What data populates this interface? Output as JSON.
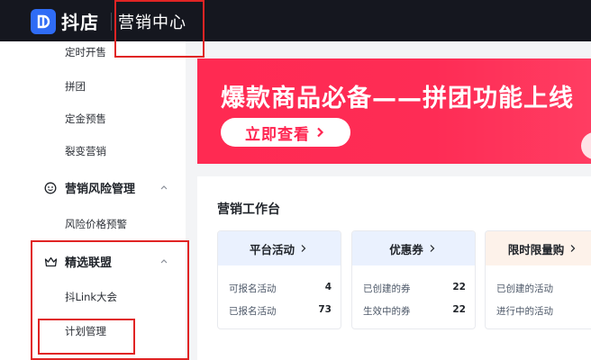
{
  "topbar": {
    "logo_text": "抖店",
    "title": "营销中心"
  },
  "sidebar": {
    "top_items": [
      "定时开售",
      "拼团",
      "定金预售",
      "裂变营销"
    ],
    "group_risk": {
      "label": "营销风险管理",
      "items": [
        "风险价格预警"
      ]
    },
    "group_alliance": {
      "label": "精选联盟",
      "items": [
        "抖Link大会",
        "计划管理"
      ]
    }
  },
  "banner": {
    "title": "爆款商品必备——拼团功能上线",
    "button_label": "立即查看"
  },
  "workbench": {
    "title": "营销工作台",
    "cards": [
      {
        "title": "平台活动",
        "header_bg": "#eaf1fe",
        "rows": [
          {
            "label": "可报名活动",
            "value": "4"
          },
          {
            "label": "已报名活动",
            "value": "73"
          }
        ]
      },
      {
        "title": "优惠券",
        "header_bg": "#eaf1fe",
        "rows": [
          {
            "label": "已创建的券",
            "value": "22"
          },
          {
            "label": "生效中的券",
            "value": "22"
          }
        ]
      },
      {
        "title": "限时限量购",
        "header_bg": "#fdf2ea",
        "rows": [
          {
            "label": "已创建的活动",
            "value": ""
          },
          {
            "label": "进行中的活动",
            "value": ""
          }
        ]
      }
    ]
  },
  "colors": {
    "topbar_bg": "#15171f",
    "brand_blue": "#2f6cf5",
    "banner_red": "#fe2c55",
    "annotation_red": "#e02424"
  }
}
